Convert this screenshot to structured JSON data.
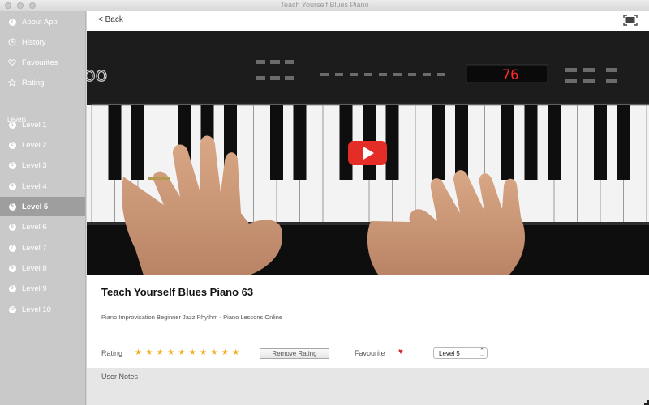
{
  "window": {
    "title": "Teach Yourself Blues Piano"
  },
  "sidebar": {
    "top_items": [
      {
        "label": "About App",
        "icon": "info-icon"
      },
      {
        "label": "History",
        "icon": "clock-icon"
      },
      {
        "label": "Favourites",
        "icon": "heart-outline-icon"
      },
      {
        "label": "Rating",
        "icon": "star-outline-icon"
      }
    ],
    "section_header": "Levels",
    "levels": [
      {
        "number": "1",
        "label": "Level 1"
      },
      {
        "number": "2",
        "label": "Level 2"
      },
      {
        "number": "3",
        "label": "Level 3"
      },
      {
        "number": "4",
        "label": "Level 4"
      },
      {
        "number": "5",
        "label": "Level 5"
      },
      {
        "number": "6",
        "label": "Level 6"
      },
      {
        "number": "7",
        "label": "Level 7"
      },
      {
        "number": "8",
        "label": "Level 8"
      },
      {
        "number": "9",
        "label": "Level 9"
      },
      {
        "number": "10",
        "label": "Level 10"
      }
    ],
    "selected": "Level 5"
  },
  "header": {
    "back_label": "< Back"
  },
  "video": {
    "display_number": "76",
    "play_color": "#e52d27"
  },
  "details": {
    "title": "Teach Yourself Blues Piano 63",
    "tags": "Piano Improvisation  Beginner Jazz Rhythm - Piano Lessons Online"
  },
  "rating": {
    "label": "Rating",
    "star_count": 10,
    "star_glyph": "★",
    "star_color": "#f0ad1e",
    "remove_label": "Remove Rating"
  },
  "favourite": {
    "label": "Favourite",
    "heart": "♥",
    "color": "#d3242d"
  },
  "level_select": {
    "selected": "Level 5",
    "arrows": "⌃⌄"
  },
  "notes": {
    "label": "User Notes"
  }
}
